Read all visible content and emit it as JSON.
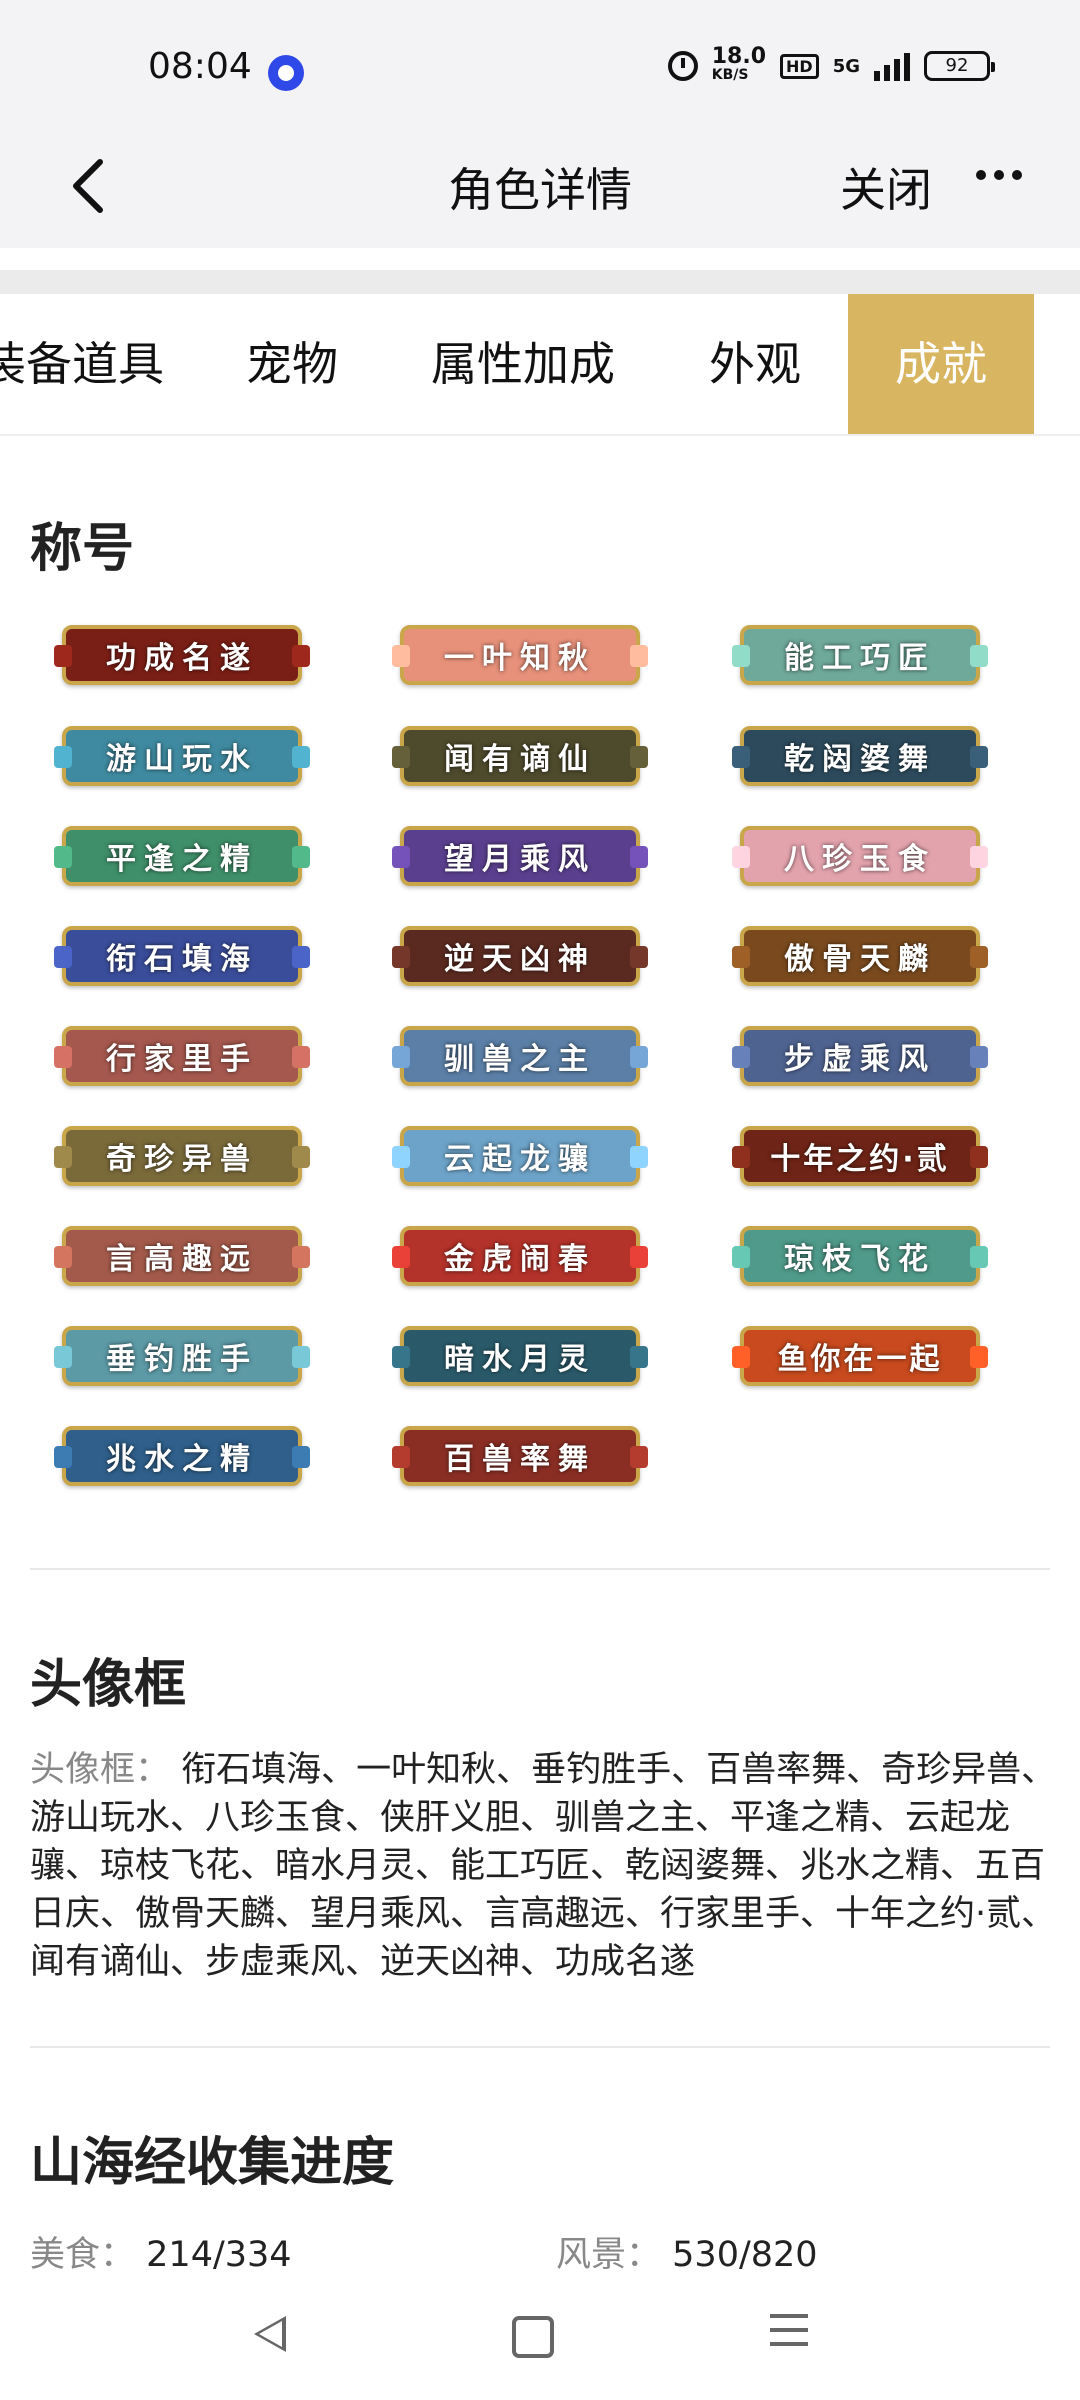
{
  "status_bar": {
    "time": "08:04",
    "speed_value": "18.0",
    "speed_unit": "KB/S",
    "hd": "HD",
    "network": "5G",
    "battery": "92"
  },
  "nav": {
    "title": "角色详情",
    "close_label": "关闭"
  },
  "tabs": [
    {
      "label": "装备道具",
      "active": false
    },
    {
      "label": "宠物",
      "active": false
    },
    {
      "label": "属性加成",
      "active": false
    },
    {
      "label": "外观",
      "active": false
    },
    {
      "label": "成就",
      "active": true
    }
  ],
  "titles_section": {
    "heading": "称号",
    "badges": [
      {
        "label": "功成名遂",
        "color": "#7a1f16"
      },
      {
        "label": "一叶知秋",
        "color": "#e7917a"
      },
      {
        "label": "能工巧匠",
        "color": "#6fa99a"
      },
      {
        "label": "游山玩水",
        "color": "#3f8aa0"
      },
      {
        "label": "闻有谪仙",
        "color": "#4e4a2c"
      },
      {
        "label": "乾闼婆舞",
        "color": "#2c4a5c"
      },
      {
        "label": "平逢之精",
        "color": "#3f8f6a"
      },
      {
        "label": "望月乘风",
        "color": "#5a3f8e"
      },
      {
        "label": "八珍玉食",
        "color": "#e3a3ad"
      },
      {
        "label": "衔石填海",
        "color": "#3a4d9a"
      },
      {
        "label": "逆天凶神",
        "color": "#5a2a20"
      },
      {
        "label": "傲骨天麟",
        "color": "#7a4a1e"
      },
      {
        "label": "行家里手",
        "color": "#a5584e"
      },
      {
        "label": "驯兽之主",
        "color": "#5b7fa6"
      },
      {
        "label": "步虚乘风",
        "color": "#4f6390"
      },
      {
        "label": "奇珍异兽",
        "color": "#7a6a3a"
      },
      {
        "label": "云起龙骧",
        "color": "#6da3c8"
      },
      {
        "label": "十年之约·贰",
        "color": "#6e2416"
      },
      {
        "label": "言高趣远",
        "color": "#a35a4a"
      },
      {
        "label": "金虎闹春",
        "color": "#b3322a"
      },
      {
        "label": "琼枝飞花",
        "color": "#4f9a8a"
      },
      {
        "label": "垂钓胜手",
        "color": "#5c9aa6"
      },
      {
        "label": "暗水月灵",
        "color": "#2a5a6a"
      },
      {
        "label": "鱼你在一起",
        "color": "#c84a1e"
      },
      {
        "label": "兆水之精",
        "color": "#2f5f8a"
      },
      {
        "label": "百兽率舞",
        "color": "#8a2e24"
      }
    ]
  },
  "avatar_section": {
    "heading": "头像框",
    "label": "头像框：",
    "content": "衔石填海、一叶知秋、垂钓胜手、百兽率舞、奇珍异兽、游山玩水、八珍玉食、侠肝义胆、驯兽之主、平逢之精、云起龙骧、琼枝飞花、暗水月灵、能工巧匠、乾闼婆舞、兆水之精、五百日庆、傲骨天麟、望月乘风、言高趣远、行家里手、十年之约·贰、闻有谪仙、步虚乘风、逆天凶神、功成名遂"
  },
  "collection_section": {
    "heading": "山海经收集进度",
    "stats": [
      {
        "label": "美食：",
        "value": "214/334"
      },
      {
        "label": "风景：",
        "value": "530/820"
      }
    ]
  }
}
